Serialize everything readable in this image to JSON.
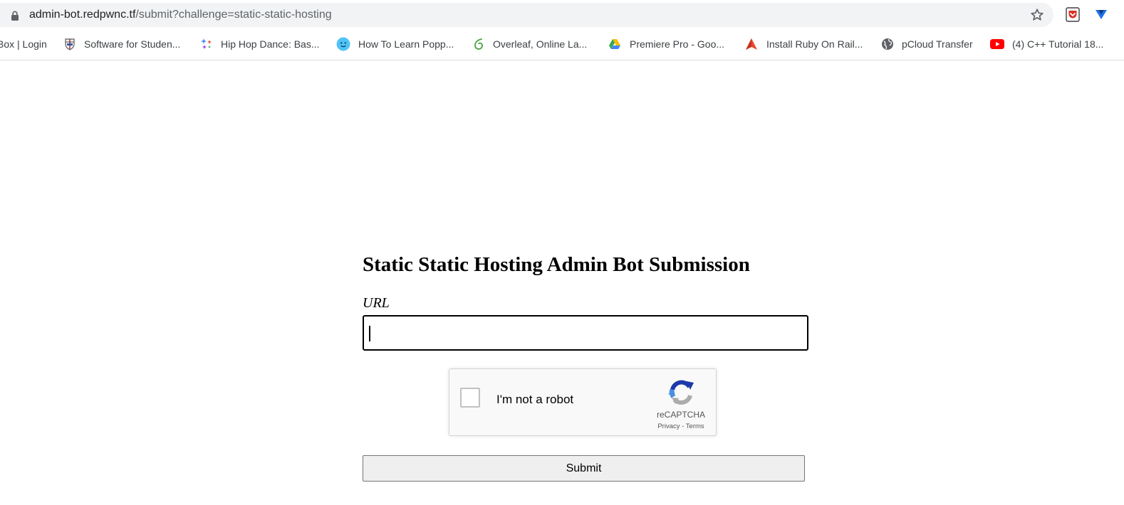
{
  "browser": {
    "url_host": "admin-bot.redpwnc.tf",
    "url_path": "/submit?challenge=static-static-hosting",
    "icons": {
      "lock": "lock-icon",
      "bookmark_star": "star-icon",
      "extension_1": "pocket-extension-icon",
      "extension_2": "extension-heart-icon"
    },
    "bookmarks": [
      {
        "label": "Box | Login",
        "icon": "none"
      },
      {
        "label": "Software for Studen...",
        "icon": "university-crest-icon"
      },
      {
        "label": "Hip Hop Dance: Bas...",
        "icon": "sparkle-icon"
      },
      {
        "label": "How To Learn Popp...",
        "icon": "smiley-icon"
      },
      {
        "label": "Overleaf, Online La...",
        "icon": "overleaf-leaf-icon"
      },
      {
        "label": "Premiere Pro - Goo...",
        "icon": "google-drive-icon"
      },
      {
        "label": "Install Ruby On Rail...",
        "icon": "gorails-icon"
      },
      {
        "label": "pCloud Transfer",
        "icon": "globe-icon"
      },
      {
        "label": "(4) C++ Tutorial 18...",
        "icon": "youtube-icon"
      }
    ]
  },
  "page": {
    "title": "Static Static Hosting Admin Bot Submission",
    "url_label": "URL",
    "url_value": ""
  },
  "recaptcha": {
    "label": "I'm not a robot",
    "brand": "reCAPTCHA",
    "privacy": "Privacy",
    "separator": " - ",
    "terms": "Terms",
    "checked": false
  },
  "form": {
    "submit_label": "Submit"
  },
  "colors": {
    "omnibox_bg": "#f1f3f4",
    "recaptcha_blue": "#1c3aa9",
    "recaptcha_light_blue": "#4a90e2",
    "recaptcha_gray": "#ababab",
    "youtube_red": "#ff0000"
  }
}
